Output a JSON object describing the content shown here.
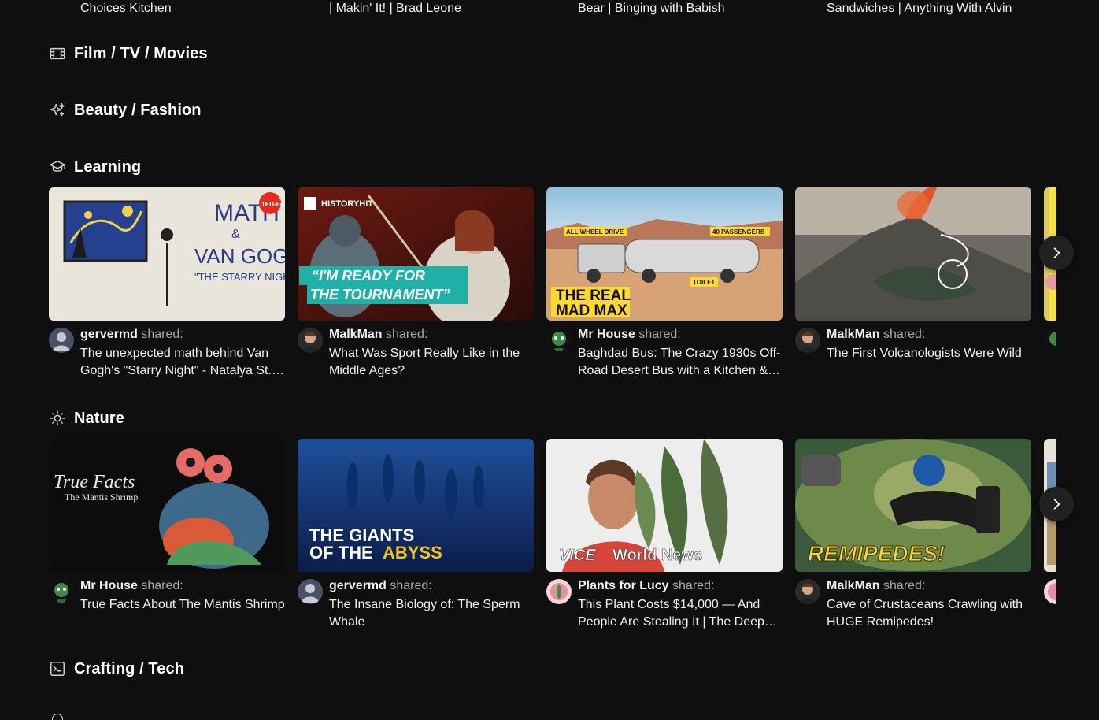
{
  "previous_row_titles": [
    "Choices Kitchen",
    "| Makin' It! | Brad Leone",
    "Bear | Binging with Babish",
    "Sandwiches | Anything With Alvin"
  ],
  "shared_suffix": "shared:",
  "sections": {
    "film": {
      "label": "Film / TV / Movies",
      "icon": "film-icon"
    },
    "beauty": {
      "label": "Beauty / Fashion",
      "icon": "sparkles-icon"
    },
    "learning": {
      "label": "Learning",
      "icon": "graduation-cap-icon",
      "cards": [
        {
          "user": "gervermd",
          "title": "The unexpected math behind Van Gogh's \"Starry Night\" - Natalya St.…",
          "thumb_text": [
            "MATH",
            "&",
            "VAN GOGH'S",
            "\"THE STARRY NIGHT\"",
            "TED-Ed"
          ]
        },
        {
          "user": "MalkMan",
          "title": "What Was Sport Really Like in the Middle Ages?",
          "thumb_text": [
            "HISTORYHIT",
            "“I'M READY FOR",
            "THE TOURNAMENT”"
          ]
        },
        {
          "user": "Mr House",
          "title": "Baghdad Bus: The Crazy 1930s Off-Road Desert Bus with a Kitchen &…",
          "thumb_text": [
            "ALL WHEEL DRIVE",
            "40 PASSENGERS",
            "TOILET",
            "THE REAL",
            "MAD MAX"
          ]
        },
        {
          "user": "MalkMan",
          "title": "The First Volcanologists Were Wild",
          "thumb_text": []
        }
      ]
    },
    "nature": {
      "label": "Nature",
      "icon": "sun-icon",
      "cards": [
        {
          "user": "Mr House",
          "title": "True Facts About The Mantis Shrimp",
          "thumb_text": [
            "True Facts",
            "The Mantis Shrimp"
          ]
        },
        {
          "user": "gervermd",
          "title": "The Insane Biology of: The Sperm Whale",
          "thumb_text": [
            "THE GIANTS",
            "OF THE",
            "ABYSS"
          ]
        },
        {
          "user": "Plants for Lucy",
          "title": "This Plant Costs $14,000 — And People Are Stealing It | The Deep…",
          "thumb_text": [
            "VICE",
            "World News"
          ]
        },
        {
          "user": "MalkMan",
          "title": "Cave of Crustaceans Crawling with HUGE Remipedes!",
          "thumb_text": [
            "REMIPEDES!"
          ]
        }
      ]
    },
    "crafting": {
      "label": "Crafting / Tech",
      "icon": "terminal-icon"
    }
  },
  "colors": {
    "background": "#0f0f10",
    "text": "#f1f1f1",
    "muted": "#aaaaaa",
    "button": "#212121"
  }
}
